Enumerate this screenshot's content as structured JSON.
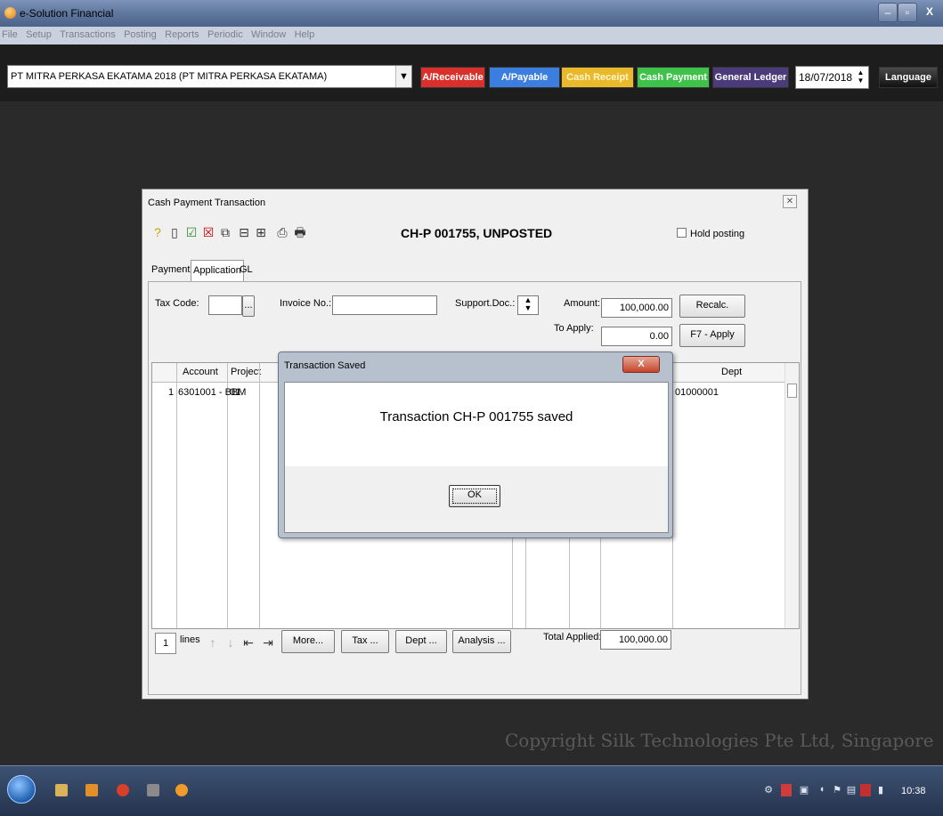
{
  "window": {
    "title": "e-Solution Financial"
  },
  "menu": [
    "File",
    "Setup",
    "Transactions",
    "Posting",
    "Reports",
    "Periodic",
    "Window",
    "Help"
  ],
  "toolbar": {
    "company": "PT MITRA PERKASA EKATAMA 2018 (PT MITRA PERKASA EKATAMA)",
    "buttons": [
      {
        "label": "A/Receivable",
        "color": "#d9302b"
      },
      {
        "label": "A/Payable",
        "color": "#3b7ee0"
      },
      {
        "label": "Cash Receipt",
        "color": "#e9b92b"
      },
      {
        "label": "Cash Payment",
        "color": "#3ec24a"
      },
      {
        "label": "General Ledger",
        "color": "#4b3b7a"
      }
    ],
    "date": "18/07/2018",
    "language": "Language"
  },
  "cash_payment": {
    "title": "Cash Payment Transaction",
    "doc_title": "CH-P 001755, UNPOSTED",
    "hold_posting": "Hold posting",
    "tabs": [
      "Payment",
      "Application",
      "GL"
    ],
    "active_tab": "Application",
    "tax_code_label": "Tax Code:",
    "tax_code_btn": "...",
    "invoice_label": "Invoice No.:",
    "support_doc_label": "Support.Doc.:",
    "amount_label": "Amount:",
    "amount_value": "100,000.00",
    "to_apply_label": "To Apply:",
    "to_apply_value": "0.00",
    "recalc": "Recalc.",
    "apply": "F7 - Apply",
    "grid": {
      "headers": [
        "Account",
        "Project",
        "Dept"
      ],
      "row": {
        "no": "1",
        "account": "6301001 - BBM",
        "project": "01",
        "dept": "01000001"
      }
    },
    "lines_count": "1",
    "lines_label": "lines",
    "more": "More...",
    "tax": "Tax ...",
    "dept": "Dept ...",
    "analysis": "Analysis ...",
    "total_applied_label": "Total Applied:",
    "total_applied_value": "100,000.00"
  },
  "dialog": {
    "title": "Transaction Saved",
    "close": "X",
    "message": "Transaction CH-P 001755 saved",
    "ok": "OK"
  },
  "copyright": "Copyright Silk Technologies Pte Ltd, Singapore",
  "taskbar": {
    "clock": "10:38"
  }
}
